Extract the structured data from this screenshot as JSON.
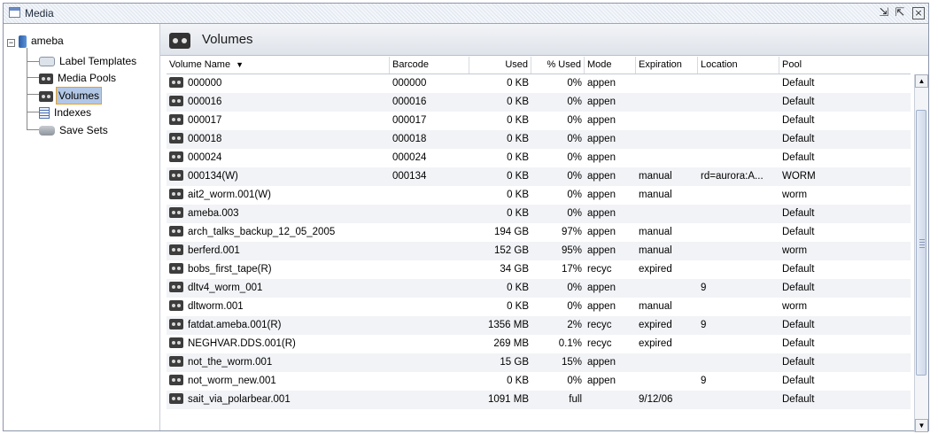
{
  "window": {
    "title": "Media"
  },
  "tree": {
    "root": {
      "label": "ameba"
    },
    "items": [
      {
        "label": "Label Templates",
        "icon": "label-template-icon"
      },
      {
        "label": "Media Pools",
        "icon": "tape-icon"
      },
      {
        "label": "Volumes",
        "icon": "tape-icon",
        "selected": true
      },
      {
        "label": "Indexes",
        "icon": "index-icon"
      },
      {
        "label": "Save Sets",
        "icon": "save-set-icon"
      }
    ]
  },
  "main": {
    "title": "Volumes"
  },
  "table": {
    "columns": {
      "name": "Volume Name",
      "barcode": "Barcode",
      "used": "Used",
      "pct": "% Used",
      "mode": "Mode",
      "expiration": "Expiration",
      "location": "Location",
      "pool": "Pool"
    },
    "rows": [
      {
        "name": "000000",
        "barcode": "000000",
        "used": "0 KB",
        "pct": "0%",
        "mode": "appen",
        "expiration": "",
        "location": "",
        "pool": "Default"
      },
      {
        "name": "000016",
        "barcode": "000016",
        "used": "0 KB",
        "pct": "0%",
        "mode": "appen",
        "expiration": "",
        "location": "",
        "pool": "Default"
      },
      {
        "name": "000017",
        "barcode": "000017",
        "used": "0 KB",
        "pct": "0%",
        "mode": "appen",
        "expiration": "",
        "location": "",
        "pool": "Default"
      },
      {
        "name": "000018",
        "barcode": "000018",
        "used": "0 KB",
        "pct": "0%",
        "mode": "appen",
        "expiration": "",
        "location": "",
        "pool": "Default"
      },
      {
        "name": "000024",
        "barcode": "000024",
        "used": "0 KB",
        "pct": "0%",
        "mode": "appen",
        "expiration": "",
        "location": "",
        "pool": "Default"
      },
      {
        "name": "000134(W)",
        "barcode": "000134",
        "used": "0 KB",
        "pct": "0%",
        "mode": "appen",
        "expiration": "manual",
        "location": "rd=aurora:A...",
        "pool": "WORM"
      },
      {
        "name": "ait2_worm.001(W)",
        "barcode": "",
        "used": "0 KB",
        "pct": "0%",
        "mode": "appen",
        "expiration": "manual",
        "location": "",
        "pool": "worm"
      },
      {
        "name": "ameba.003",
        "barcode": "",
        "used": "0 KB",
        "pct": "0%",
        "mode": "appen",
        "expiration": "",
        "location": "",
        "pool": "Default"
      },
      {
        "name": "arch_talks_backup_12_05_2005",
        "barcode": "",
        "used": "194 GB",
        "pct": "97%",
        "mode": "appen",
        "expiration": "manual",
        "location": "",
        "pool": "Default"
      },
      {
        "name": "berferd.001",
        "barcode": "",
        "used": "152 GB",
        "pct": "95%",
        "mode": "appen",
        "expiration": "manual",
        "location": "",
        "pool": "worm"
      },
      {
        "name": "bobs_first_tape(R)",
        "barcode": "",
        "used": "34 GB",
        "pct": "17%",
        "mode": "recyc",
        "expiration": "expired",
        "location": "",
        "pool": "Default"
      },
      {
        "name": "dltv4_worm_001",
        "barcode": "",
        "used": "0 KB",
        "pct": "0%",
        "mode": "appen",
        "expiration": "",
        "location": "9",
        "pool": "Default"
      },
      {
        "name": "dltworm.001",
        "barcode": "",
        "used": "0 KB",
        "pct": "0%",
        "mode": "appen",
        "expiration": "manual",
        "location": "",
        "pool": "worm"
      },
      {
        "name": "fatdat.ameba.001(R)",
        "barcode": "",
        "used": "1356 MB",
        "pct": "2%",
        "mode": "recyc",
        "expiration": "expired",
        "location": "9",
        "pool": "Default"
      },
      {
        "name": "NEGHVAR.DDS.001(R)",
        "barcode": "",
        "used": "269 MB",
        "pct": "0.1%",
        "mode": "recyc",
        "expiration": "expired",
        "location": "",
        "pool": "Default"
      },
      {
        "name": "not_the_worm.001",
        "barcode": "",
        "used": "15 GB",
        "pct": "15%",
        "mode": "appen",
        "expiration": "",
        "location": "",
        "pool": "Default"
      },
      {
        "name": "not_worm_new.001",
        "barcode": "",
        "used": "0 KB",
        "pct": "0%",
        "mode": "appen",
        "expiration": "",
        "location": "9",
        "pool": "Default"
      },
      {
        "name": "sait_via_polarbear.001",
        "barcode": "",
        "used": "1091 MB",
        "pct": "full",
        "mode": "",
        "expiration": "9/12/06",
        "location": "",
        "pool": "Default"
      }
    ]
  }
}
